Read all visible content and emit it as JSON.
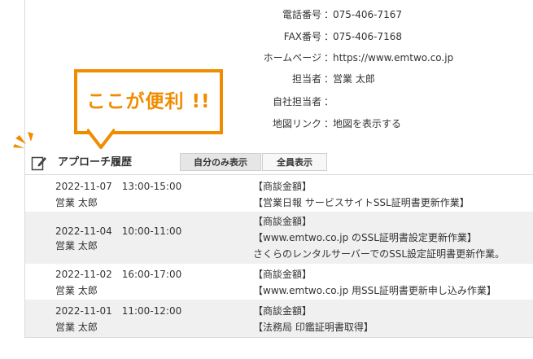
{
  "company_info": [
    {
      "label": "電話番号",
      "value": "075-406-7167"
    },
    {
      "label": "FAX番号",
      "value": "075-406-7168"
    },
    {
      "label": "ホームページ",
      "value": "https://www.emtwo.co.jp"
    },
    {
      "label": "担当者",
      "value": "営業 太郎"
    },
    {
      "label": "自社担当者",
      "value": ""
    },
    {
      "label": "地図リンク",
      "value": "地図を表示する"
    }
  ],
  "separator": "：",
  "callout": {
    "text": "ここが便利 !!",
    "color": "#f08c00"
  },
  "history": {
    "title": "アプローチ履歴",
    "tabs": [
      {
        "label": "自分のみ表示",
        "active": true
      },
      {
        "label": "全員表示",
        "active": false
      }
    ],
    "rows": [
      {
        "datetime": "2022-11-07　13:00-15:00",
        "person": "営業 太郎",
        "lines": [
          "【商談金額】",
          "【営業日報 サービスサイトSSL証明書更新作業】"
        ]
      },
      {
        "datetime": "2022-11-04　10:00-11:00",
        "person": "営業 太郎",
        "lines": [
          "【商談金額】",
          "【www.emtwo.co.jp のSSL証明書設定更新作業】",
          "さくらのレンタルサーバーでのSSL設定証明書更新作業。"
        ]
      },
      {
        "datetime": "2022-11-02　16:00-17:00",
        "person": "営業 太郎",
        "lines": [
          "【商談金額】",
          "【www.emtwo.co.jp 用SSL証明書更新申し込み作業】"
        ]
      },
      {
        "datetime": "2022-11-01　11:00-12:00",
        "person": "営業 太郎",
        "lines": [
          "【商談金額】",
          "【法務局 印鑑証明書取得】"
        ]
      }
    ]
  }
}
